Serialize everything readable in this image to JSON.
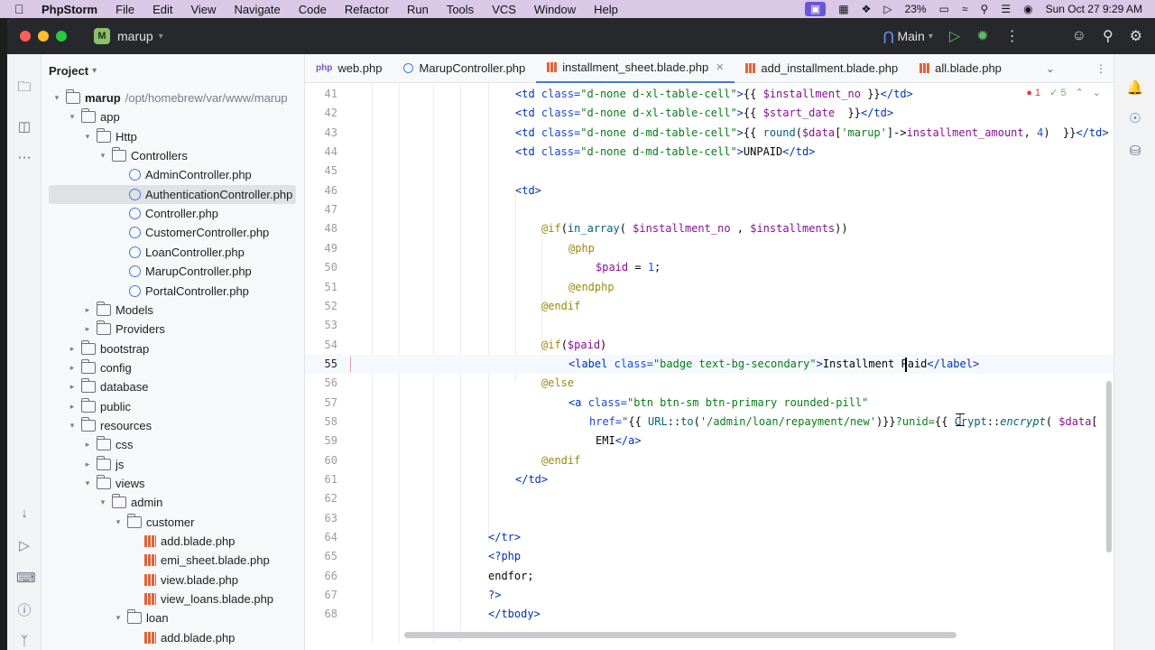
{
  "menubar": {
    "app_name": "PhpStorm",
    "items": [
      "File",
      "Edit",
      "View",
      "Navigate",
      "Code",
      "Refactor",
      "Run",
      "Tools",
      "VCS",
      "Window",
      "Help"
    ],
    "battery": "23%",
    "datetime": "Sun Oct 27  9:29 AM"
  },
  "titlebar": {
    "project_badge": "M",
    "project_name": "marup",
    "branch": "Main"
  },
  "project_panel": {
    "title": "Project",
    "tree": [
      {
        "label": "marup",
        "path": "/opt/homebrew/var/www/marup",
        "type": "folder",
        "depth": 0,
        "expanded": true,
        "bold": true
      },
      {
        "label": "app",
        "type": "folder",
        "depth": 1,
        "expanded": true
      },
      {
        "label": "Http",
        "type": "folder",
        "depth": 2,
        "expanded": true
      },
      {
        "label": "Controllers",
        "type": "folder",
        "depth": 3,
        "expanded": true
      },
      {
        "label": "AdminController.php",
        "type": "class",
        "depth": 4
      },
      {
        "label": "AuthenticationController.php",
        "type": "class",
        "depth": 4,
        "selected": true
      },
      {
        "label": "Controller.php",
        "type": "class",
        "depth": 4
      },
      {
        "label": "CustomerController.php",
        "type": "class",
        "depth": 4
      },
      {
        "label": "LoanController.php",
        "type": "class",
        "depth": 4
      },
      {
        "label": "MarupController.php",
        "type": "class",
        "depth": 4
      },
      {
        "label": "PortalController.php",
        "type": "class",
        "depth": 4
      },
      {
        "label": "Models",
        "type": "folder",
        "depth": 2,
        "expanded": false
      },
      {
        "label": "Providers",
        "type": "folder",
        "depth": 2,
        "expanded": false
      },
      {
        "label": "bootstrap",
        "type": "folder",
        "depth": 1,
        "expanded": false
      },
      {
        "label": "config",
        "type": "folder",
        "depth": 1,
        "expanded": false
      },
      {
        "label": "database",
        "type": "folder",
        "depth": 1,
        "expanded": false
      },
      {
        "label": "public",
        "type": "folder",
        "depth": 1,
        "expanded": false
      },
      {
        "label": "resources",
        "type": "folder",
        "depth": 1,
        "expanded": true
      },
      {
        "label": "css",
        "type": "folder",
        "depth": 2,
        "expanded": false
      },
      {
        "label": "js",
        "type": "folder",
        "depth": 2,
        "expanded": false
      },
      {
        "label": "views",
        "type": "folder",
        "depth": 2,
        "expanded": true
      },
      {
        "label": "admin",
        "type": "folder",
        "depth": 3,
        "expanded": true
      },
      {
        "label": "customer",
        "type": "folder",
        "depth": 4,
        "expanded": true
      },
      {
        "label": "add.blade.php",
        "type": "blade",
        "depth": 5
      },
      {
        "label": "emi_sheet.blade.php",
        "type": "blade",
        "depth": 5
      },
      {
        "label": "view.blade.php",
        "type": "blade",
        "depth": 5
      },
      {
        "label": "view_loans.blade.php",
        "type": "blade",
        "depth": 5
      },
      {
        "label": "loan",
        "type": "folder",
        "depth": 4,
        "expanded": true
      },
      {
        "label": "add.blade.php",
        "type": "blade",
        "depth": 5
      }
    ]
  },
  "tabs": [
    {
      "label": "web.php",
      "icon": "php",
      "active": false
    },
    {
      "label": "MarupController.php",
      "icon": "class",
      "active": false
    },
    {
      "label": "installment_sheet.blade.php",
      "icon": "blade",
      "active": true
    },
    {
      "label": "add_installment.blade.php",
      "icon": "blade",
      "active": false
    },
    {
      "label": "all.blade.php",
      "icon": "blade",
      "active": false
    }
  ],
  "inspections": {
    "errors": "1",
    "checks": "5"
  },
  "editor": {
    "current_line": 55,
    "lines": [
      {
        "no": 41,
        "html": "<span class='t'>&lt;td</span> <span class='a'>class=</span><span class='s'>\"d-none d-xl-table-cell\"</span><span class='t'>&gt;</span>{{ <span class='v'>$installment_no</span> }}<span class='t'>&lt;/td&gt;</span>"
      },
      {
        "no": 42,
        "html": "<span class='t'>&lt;td</span> <span class='a'>class=</span><span class='s'>\"d-none d-xl-table-cell\"</span><span class='t'>&gt;</span>{{ <span class='v'>$start_date</span>  }}<span class='t'>&lt;/td&gt;</span>"
      },
      {
        "no": 43,
        "html": "<span class='t'>&lt;td</span> <span class='a'>class=</span><span class='s'>\"d-none d-md-table-cell\"</span><span class='t'>&gt;</span>{{ <span class='f'>round</span>(<span class='v'>$data</span>[<span class='s'>'marup'</span>]-&gt;<span class='v'>installment_amount</span>, <span class='n'>4</span>)  }}<span class='t'>&lt;/td&gt;</span>"
      },
      {
        "no": 44,
        "html": "<span class='t'>&lt;td</span> <span class='a'>class=</span><span class='s'>\"d-none d-md-table-cell\"</span><span class='t'>&gt;</span>UNPAID<span class='t'>&lt;/td&gt;</span>"
      },
      {
        "no": 45,
        "html": ""
      },
      {
        "no": 46,
        "html": "<span class='t'>&lt;td&gt;</span>"
      },
      {
        "no": 47,
        "html": ""
      },
      {
        "no": 48,
        "html": "<span class='d'>@if</span>(<span class='f'>in_array</span>( <span class='v'>$installment_no</span> , <span class='v'>$installments</span>))"
      },
      {
        "no": 49,
        "html": "<span class='d'>@php</span>"
      },
      {
        "no": 50,
        "html": "<span class='v'>$paid</span> = <span class='n'>1</span>;"
      },
      {
        "no": 51,
        "html": "<span class='d'>@endphp</span>"
      },
      {
        "no": 52,
        "html": "<span class='d'>@endif</span>"
      },
      {
        "no": 53,
        "html": ""
      },
      {
        "no": 54,
        "html": "<span class='d'>@if</span>(<span class='v'>$paid</span>)"
      },
      {
        "no": 55,
        "html": "<span class='t'>&lt;label</span> <span class='a'>class=</span><span class='s'>\"badge text-bg-secondary\"</span><span class='t'>&gt;</span>Installment Paid<span class='t'>&lt;/label&gt;</span>"
      },
      {
        "no": 56,
        "html": "<span class='d'>@else</span>"
      },
      {
        "no": 57,
        "html": "<span class='t'>&lt;a</span> <span class='a'>class=</span><span class='s'>\"btn btn-sm btn-primary rounded-pill\"</span>"
      },
      {
        "no": 58,
        "html": "<span class='a'>href=</span><span class='s'>\"</span>{{ <span class='f'>URL</span>::<span class='f'>to</span>(<span class='s'>'/admin/loan/repayment/new'</span>)}}<span class='s'>?unid=</span>{{ <span class='f'>Crypt</span>::<span class='i'>encrypt</span>( <span class='v'>$data</span>["
      },
      {
        "no": 59,
        "html": "EMI<span class='t'>&lt;/a&gt;</span>"
      },
      {
        "no": 60,
        "html": "<span class='d'>@endif</span>"
      },
      {
        "no": 61,
        "html": "<span class='t'>&lt;/td&gt;</span>"
      },
      {
        "no": 62,
        "html": ""
      },
      {
        "no": 63,
        "html": ""
      },
      {
        "no": 64,
        "html": "<span class='t'>&lt;/tr&gt;</span>"
      },
      {
        "no": 65,
        "html": "<span class='t'>&lt;?php</span>"
      },
      {
        "no": 66,
        "html": "endfor;"
      },
      {
        "no": 67,
        "html": "<span class='t'>?&gt;</span>"
      },
      {
        "no": 68,
        "html": "<span class='t'>&lt;/tbody&gt;</span>"
      }
    ]
  },
  "colors": {
    "accent": "#3f7ed6",
    "menubar_bg": "#d9c8e6",
    "titlebar_bg": "#27282c",
    "selection_bg": "#dfe1e5"
  }
}
